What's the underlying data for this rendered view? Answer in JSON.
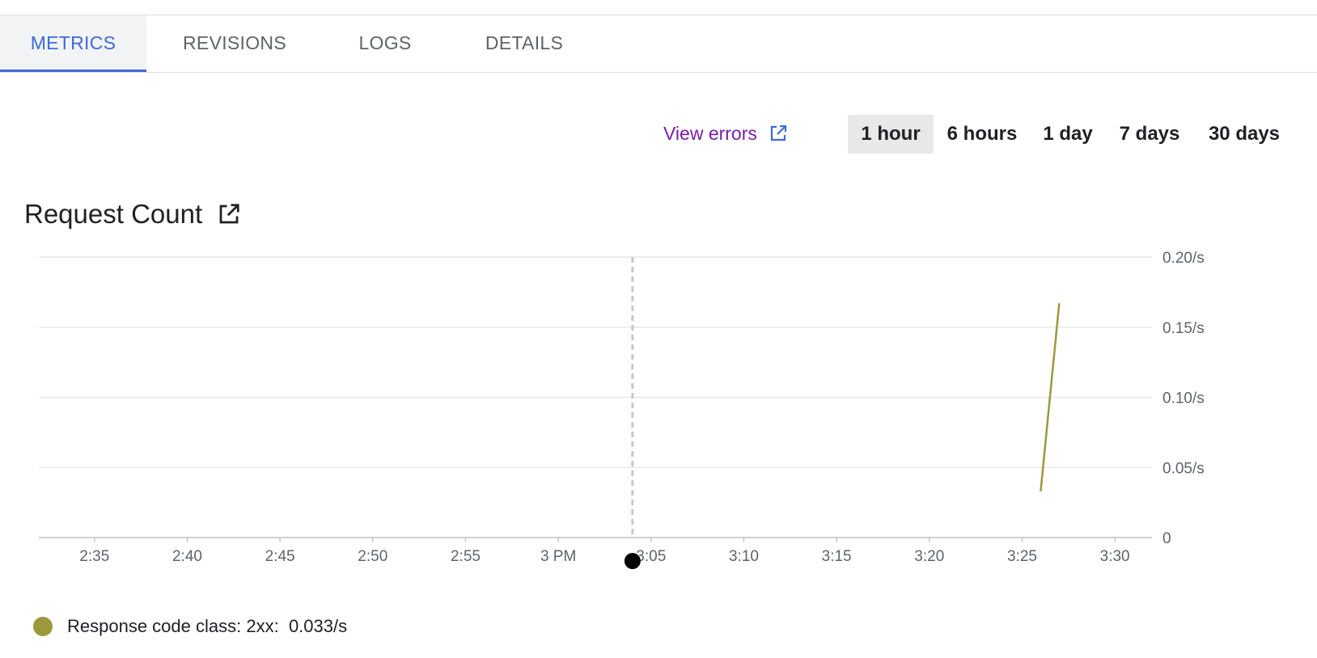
{
  "tabs": [
    {
      "label": "METRICS",
      "active": true
    },
    {
      "label": "REVISIONS",
      "active": false
    },
    {
      "label": "LOGS",
      "active": false
    },
    {
      "label": "DETAILS",
      "active": false
    }
  ],
  "toolbar": {
    "view_errors_label": "View errors",
    "ranges": [
      {
        "label": "1 hour",
        "selected": true
      },
      {
        "label": "6 hours",
        "selected": false
      },
      {
        "label": "1 day",
        "selected": false
      },
      {
        "label": "7 days",
        "selected": false
      },
      {
        "label": "30 days",
        "selected": false
      }
    ]
  },
  "icons": {
    "view_errors": "external-link-icon",
    "chart_title": "open-in-new-icon"
  },
  "chart_data": {
    "type": "line",
    "title": "Request Count",
    "xlabel": "",
    "ylabel": "",
    "x_ticks": [
      "2:35",
      "2:40",
      "2:45",
      "2:50",
      "2:55",
      "3 PM",
      "3:05",
      "3:10",
      "3:15",
      "3:20",
      "3:25",
      "3:30"
    ],
    "y_ticks": [
      "0",
      "0.05/s",
      "0.10/s",
      "0.15/s",
      "0.20/s"
    ],
    "ylim": [
      0,
      0.2
    ],
    "xlim": [
      "2:32",
      "3:32"
    ],
    "grid": true,
    "cursor_time": "3:04",
    "series": [
      {
        "name": "Response code class: 2xx",
        "color": "#9a9a3c",
        "points": [
          {
            "x": "3:26",
            "y": 0.033
          },
          {
            "x": "3:27",
            "y": 0.167
          }
        ]
      }
    ]
  },
  "legend": {
    "label": "Response code class: 2xx:",
    "value": "0.033/s",
    "color": "#9a9a3c"
  },
  "colors": {
    "accent": "#3f6ad8",
    "link": "#7a1fa2",
    "grid": "#e8e8e8",
    "cursor": "#c8c8c8"
  }
}
